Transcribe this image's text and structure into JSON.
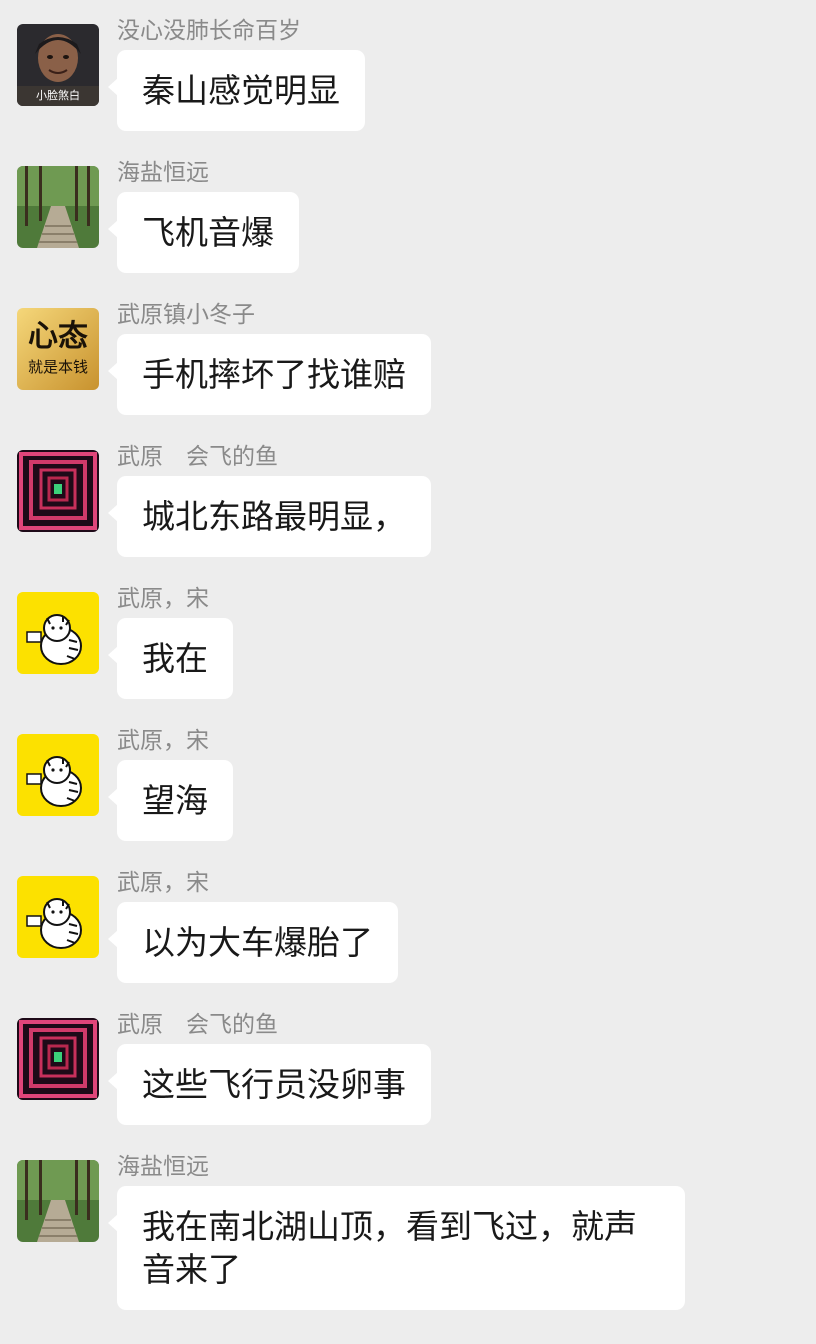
{
  "messages": [
    {
      "sender": "没心没肺长命百岁",
      "text": "秦山感觉明显",
      "avatar_label": "小脸煞白",
      "avatar_icon": "man-portrait-avatar"
    },
    {
      "sender": "海盐恒远",
      "text": "飞机音爆",
      "avatar_icon": "forest-path-avatar"
    },
    {
      "sender": "武原镇小冬子",
      "text": "手机摔坏了找谁赔",
      "avatar_label": "心态就是本钱",
      "avatar_icon": "calligraphy-avatar"
    },
    {
      "sender": "武原　会飞的鱼",
      "text": "城北东路最明显，",
      "avatar_icon": "neon-tunnel-avatar"
    },
    {
      "sender": "武原，宋",
      "text": "我在",
      "avatar_icon": "cartoon-cat-avatar"
    },
    {
      "sender": "武原，宋",
      "text": "望海",
      "avatar_icon": "cartoon-cat-avatar"
    },
    {
      "sender": "武原，宋",
      "text": "以为大车爆胎了",
      "avatar_icon": "cartoon-cat-avatar"
    },
    {
      "sender": "武原　会飞的鱼",
      "text": "这些飞行员没卵事",
      "avatar_icon": "neon-tunnel-avatar"
    },
    {
      "sender": "海盐恒远",
      "text": "我在南北湖山顶，看到飞过，就声音来了",
      "avatar_icon": "forest-path-avatar"
    }
  ],
  "colors": {
    "background": "#ededed",
    "bubble": "#ffffff",
    "sender_text": "#8a8a8a",
    "message_text": "#191919",
    "cat_avatar_bg": "#fce100"
  }
}
